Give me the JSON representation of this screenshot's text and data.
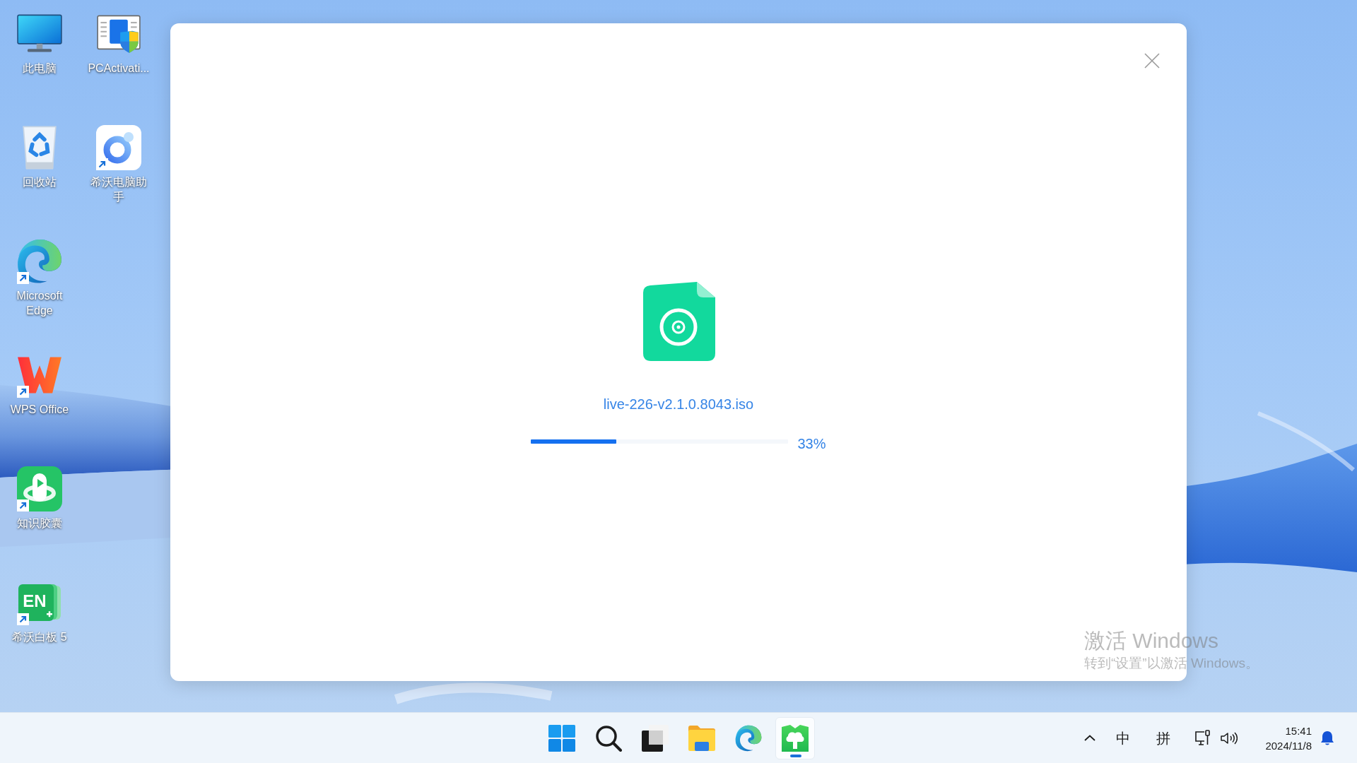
{
  "desktop_icons": [
    {
      "label": "此电脑",
      "kind": "computer",
      "shortcut": false
    },
    {
      "label": "回收站",
      "kind": "recycle_bin",
      "shortcut": false
    },
    {
      "label": "Microsoft Edge",
      "kind": "edge",
      "shortcut": true
    },
    {
      "label": "WPS Office",
      "kind": "wps",
      "shortcut": true
    },
    {
      "label": "知识胶囊",
      "kind": "capsule",
      "shortcut": true
    },
    {
      "label": "希沃白板 5",
      "kind": "whiteboard",
      "shortcut": true,
      "logo_text": "EN"
    },
    {
      "label": "PCActivati...",
      "kind": "activation",
      "shortcut": false
    },
    {
      "label": "希沃电脑助手",
      "kind": "assistant",
      "shortcut": true
    }
  ],
  "dialog": {
    "file_name": "live-226-v2.1.0.8043.iso",
    "progress": {
      "level": 0.33,
      "reading": "33%"
    }
  },
  "activation_notice": {
    "title": "激活 Windows",
    "message": "转到“设置”以激活 Windows。"
  },
  "taskbar": {
    "apps": [
      {
        "kind": "start",
        "active": false
      },
      {
        "kind": "search",
        "active": false
      },
      {
        "kind": "task_view",
        "active": false
      },
      {
        "kind": "explorer",
        "active": false
      },
      {
        "kind": "edge",
        "active": false
      },
      {
        "kind": "tree_app",
        "active": true
      }
    ],
    "tray": {
      "input_mode": "中",
      "input_method": "拼",
      "time": "15:41",
      "date": "2024/11/8"
    }
  }
}
